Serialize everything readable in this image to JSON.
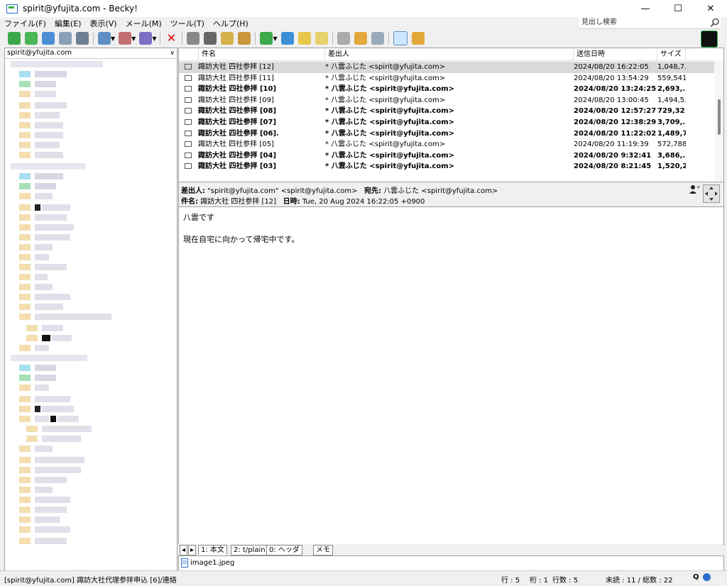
{
  "window": {
    "title": "spirit@yfujita.com - Becky!",
    "minimize": "—",
    "maximize": "☐",
    "close": "✕"
  },
  "menu": [
    "ファイル(F)",
    "編集(E)",
    "表示(V)",
    "メール(M)",
    "ツール(T)",
    "ヘルプ(H)"
  ],
  "search": {
    "placeholder": "見出し検索"
  },
  "folder": {
    "account": "spirit@yfujita.com"
  },
  "list": {
    "columns": {
      "subject": "件名",
      "from": "差出人",
      "date": "送信日時",
      "size": "サイズ"
    },
    "rows": [
      {
        "subject": "諏訪大社 四社参拝 [12]",
        "from": "* 八雲ふじた <spirit@yfujita.com>",
        "date": "2024/08/20 16:22:05",
        "size": "1,048,7...",
        "selected": true,
        "unread": false
      },
      {
        "subject": "諏訪大社 四社参拝 [11]",
        "from": "* 八雲ふじた <spirit@yfujita.com>",
        "date": "2024/08/20 13:54:29",
        "size": "559,541",
        "selected": false,
        "unread": false
      },
      {
        "subject": "諏訪大社 四社参拝 [10]",
        "from": "* 八雲ふじた <spirit@yfujita.com>",
        "date": "2024/08/20 13:24:25",
        "size": "2,693,...",
        "selected": false,
        "unread": true
      },
      {
        "subject": "諏訪大社 四社参拝 [09]",
        "from": "* 八雲ふじた <spirit@yfujita.com>",
        "date": "2024/08/20 13:00:45",
        "size": "1,494,5...",
        "selected": false,
        "unread": false
      },
      {
        "subject": "諏訪大社 四社参拝 [08]",
        "from": "* 八雲ふじた <spirit@yfujita.com>",
        "date": "2024/08/20 12:57:27",
        "size": "729,321",
        "selected": false,
        "unread": true
      },
      {
        "subject": "諏訪大社 四社参拝 [07]",
        "from": "* 八雲ふじた <spirit@yfujita.com>",
        "date": "2024/08/20 12:38:29",
        "size": "3,709,...",
        "selected": false,
        "unread": true
      },
      {
        "subject": "諏訪大社 四社参拝 [06].",
        "from": "* 八雲ふじた <spirit@yfujita.com>",
        "date": "2024/08/20 11:22:02",
        "size": "1,489,7...",
        "selected": false,
        "unread": true
      },
      {
        "subject": "諏訪大社 四社参拝 [05]",
        "from": "* 八雲ふじた <spirit@yfujita.com>",
        "date": "2024/08/20 11:19:39",
        "size": "572,788",
        "selected": false,
        "unread": false
      },
      {
        "subject": "諏訪大社 四社参拝 [04]",
        "from": "* 八雲ふじた <spirit@yfujita.com>",
        "date": "2024/08/20 9:32:41",
        "size": "3,686,...",
        "selected": false,
        "unread": true
      },
      {
        "subject": "諏訪大社 四社参拝 [03]",
        "from": "* 八雲ふじた <spirit@yfujita.com>",
        "date": "2024/08/20 8:21:45",
        "size": "1,520,2...",
        "selected": false,
        "unread": true
      }
    ]
  },
  "header": {
    "from_label": "差出人:",
    "from_value": "\"spirit@yfujita.com\" <spirit@yfujita.com>",
    "to_label": "宛先:",
    "to_value": "八雲ふじた <spirit@yfujita.com>",
    "subject_label": "件名:",
    "subject_value": "諏訪大社 四社参拝 [12]",
    "date_label": "日時:",
    "date_value": "Tue, 20 Aug 2024 16:22:05 +0900"
  },
  "body": {
    "line1": "八雲です",
    "line2": "現在自宅に向かって帰宅中です。"
  },
  "tabs": {
    "t1": "1: 本文",
    "t2": "2: t/plain",
    "t3": "0: ヘッダ",
    "memo": "メモ"
  },
  "attachment": {
    "name": "image1.jpeg"
  },
  "status": {
    "left": "[spirit@yfujita.com] 諏訪大社代理参拝申込 [6]/連絡",
    "row": "行 : 5",
    "col": "桁 : 1",
    "lines": "行数 : 5",
    "unread": "未読 :    11 / 総数 :    22"
  },
  "colors": {
    "accent": "#2a6fd0",
    "selected_row": "#d9d9d9"
  }
}
